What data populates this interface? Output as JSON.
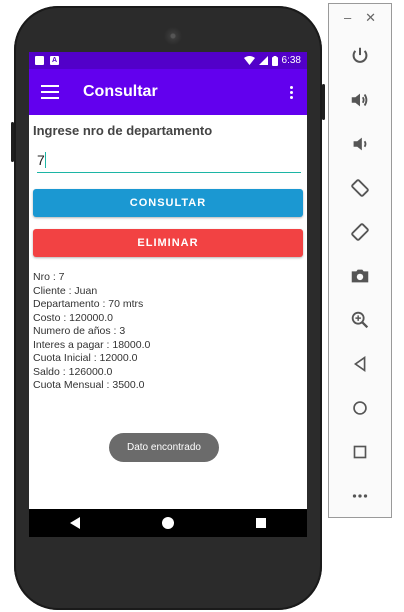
{
  "status_bar": {
    "time": "6:38"
  },
  "app_bar": {
    "title": "Consultar"
  },
  "form": {
    "prompt": "Ingrese nro de departamento",
    "input_value": "7",
    "consultar_label": "CONSULTAR",
    "eliminar_label": "ELIMINAR"
  },
  "results": [
    "Nro : 7",
    "Cliente : Juan",
    "Departamento : 70 mtrs",
    "Costo : 120000.0",
    "Numero de años : 3",
    "Interes a pagar : 18000.0",
    "Cuota Inicial : 12000.0",
    "Saldo : 126000.0",
    "Cuota Mensual : 3500.0"
  ],
  "toast": {
    "message": "Dato encontrado"
  },
  "emulator_panel": {
    "minimize_label": "–",
    "close_label": "✕",
    "tools": [
      "power-icon",
      "volume-up-icon",
      "volume-down-icon",
      "rotate-left-icon",
      "rotate-right-icon",
      "camera-icon",
      "zoom-icon",
      "back-icon",
      "home-icon",
      "overview-icon",
      "more-icon"
    ]
  },
  "colors": {
    "status_bar": "#5200c9",
    "app_bar": "#6200ee",
    "consultar_button": "#1b98d2",
    "eliminar_button": "#f24243",
    "input_underline": "#1cb5a5"
  }
}
